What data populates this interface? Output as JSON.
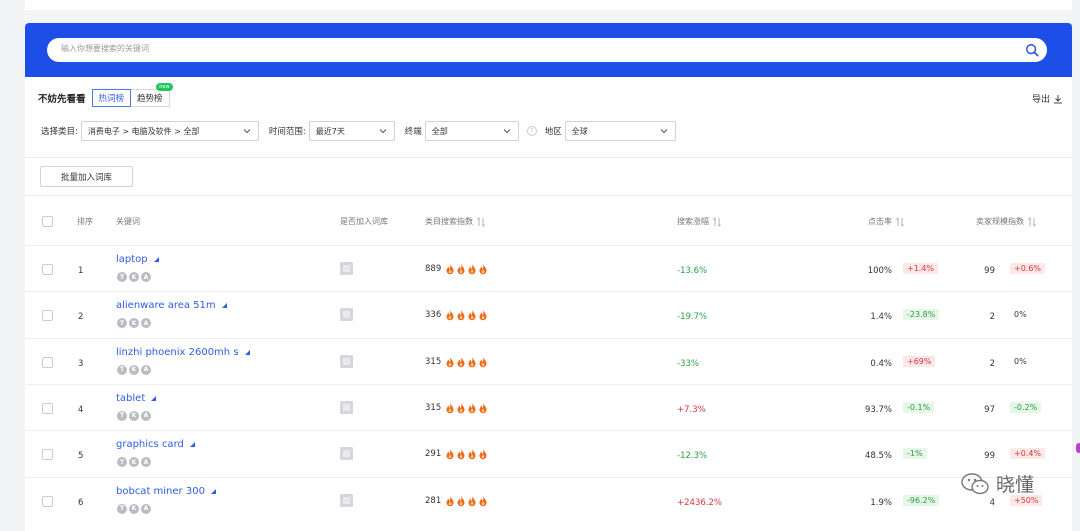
{
  "search": {
    "placeholder": "输入你想要搜索的关键词"
  },
  "toolbar": {
    "try_label": "不妨先看看",
    "tabs": [
      {
        "label": "热词榜",
        "active": true
      },
      {
        "label": "趋势榜",
        "active": false,
        "badge": "new"
      }
    ],
    "export_label": "导出"
  },
  "filters": {
    "category_label": "选择类目:",
    "category_value": "消费电子 > 电脑及软件 > 全部",
    "time_label": "时间范围:",
    "time_value": "最近7天",
    "channel_label": "终端",
    "channel_value": "全部",
    "region_label": "地区",
    "region_value": "全球"
  },
  "batch_button": "批量加入词库",
  "columns": {
    "rank": "排序",
    "keyword": "关键词",
    "added": "是否加入词库",
    "index": "类目搜索指数",
    "growth": "搜索涨幅",
    "ctr": "点击率",
    "competition": "卖家规模指数"
  },
  "rows": [
    {
      "rank": "1",
      "keyword": "laptop",
      "index": "889",
      "growth": "-13.6%",
      "growth_dir": "green",
      "ctr": "100%",
      "ctr_tag": "+1.4%",
      "ctr_tag_dir": "red",
      "comp": "99",
      "comp_tag": "+0.6%",
      "comp_tag_dir": "red"
    },
    {
      "rank": "2",
      "keyword": "alienware area 51m",
      "index": "336",
      "growth": "-19.7%",
      "growth_dir": "green",
      "ctr": "1.4%",
      "ctr_tag": "-23.8%",
      "ctr_tag_dir": "green",
      "comp": "2",
      "comp_tag": "0%",
      "comp_tag_dir": "plain"
    },
    {
      "rank": "3",
      "keyword": "linzhi phoenix 2600mh s",
      "index": "315",
      "growth": "-33%",
      "growth_dir": "green",
      "ctr": "0.4%",
      "ctr_tag": "+69%",
      "ctr_tag_dir": "red",
      "comp": "2",
      "comp_tag": "0%",
      "comp_tag_dir": "plain"
    },
    {
      "rank": "4",
      "keyword": "tablet",
      "index": "315",
      "growth": "+7.3%",
      "growth_dir": "red",
      "ctr": "93.7%",
      "ctr_tag": "-0.1%",
      "ctr_tag_dir": "green",
      "comp": "97",
      "comp_tag": "-0.2%",
      "comp_tag_dir": "green"
    },
    {
      "rank": "5",
      "keyword": "graphics card",
      "index": "291",
      "growth": "-12.3%",
      "growth_dir": "green",
      "ctr": "48.5%",
      "ctr_tag": "-1%",
      "ctr_tag_dir": "green",
      "comp": "99",
      "comp_tag": "+0.4%",
      "comp_tag_dir": "red"
    },
    {
      "rank": "6",
      "keyword": "bobcat miner 300",
      "index": "281",
      "growth": "+2436.2%",
      "growth_dir": "red",
      "ctr": "1.9%",
      "ctr_tag": "-96.2%",
      "ctr_tag_dir": "green",
      "comp": "4",
      "comp_tag": "+50%",
      "comp_tag_dir": "red"
    }
  ],
  "row_mini_icons": [
    "T",
    "K",
    "A"
  ],
  "watermark": {
    "text": "晓懂"
  },
  "colors": {
    "brand_blue": "#1e4ee8",
    "up_red": "#d9363e",
    "down_green": "#2ca044",
    "flame": "#f06a1d"
  }
}
